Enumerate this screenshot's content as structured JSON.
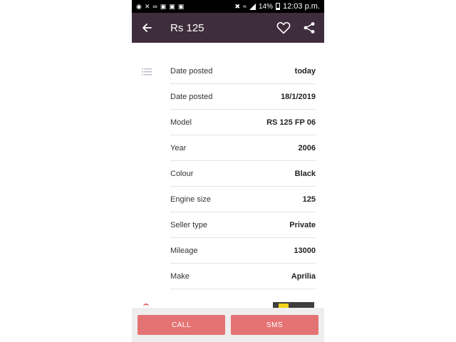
{
  "statusbar": {
    "battery": "14%",
    "time": "12:03 p.m."
  },
  "appbar": {
    "title": "Rs 125",
    "icons": [
      "back-arrow-icon",
      "heart-icon",
      "share-icon"
    ]
  },
  "details": [
    {
      "label": "Date posted",
      "value": "today"
    },
    {
      "label": "Date posted",
      "value": "18/1/2019"
    },
    {
      "label": "Model",
      "value": "RS 125 FP 06"
    },
    {
      "label": "Year",
      "value": "2006"
    },
    {
      "label": "Colour",
      "value": "Black"
    },
    {
      "label": "Engine size",
      "value": "125"
    },
    {
      "label": "Seller type",
      "value": "Private"
    },
    {
      "label": "Mileage",
      "value": "13000"
    },
    {
      "label": "Make",
      "value": "Aprilia"
    }
  ],
  "actions": {
    "call_label": "CALL",
    "sms_label": "SMS"
  },
  "colors": {
    "appbar": "#3e2d3c",
    "button": "#e57373",
    "statusbar": "#000000"
  }
}
